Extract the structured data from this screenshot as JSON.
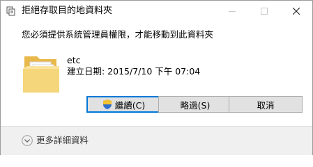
{
  "window": {
    "title": "拒絕存取目的地資料夾",
    "controls": {
      "minimize": "—",
      "maximize": "□",
      "close": "✕"
    }
  },
  "message": "您必須提供系統管理員權限，才能移動到此資料夾",
  "item": {
    "name": "etc",
    "created": "建立日期: 2015/7/10 下午 07:04"
  },
  "buttons": {
    "continue": "繼續(C)",
    "skip": "略過(S)",
    "cancel": "取消"
  },
  "footer": {
    "more_details": "更多詳細資料"
  },
  "colors": {
    "accent": "#0078d7",
    "folder_front": "#f5d67a",
    "folder_back": "#e8b84a"
  }
}
